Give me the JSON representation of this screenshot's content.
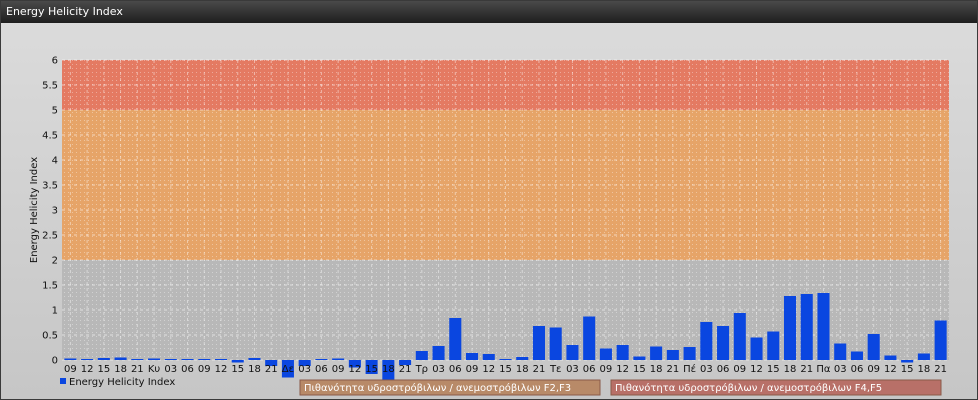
{
  "window": {
    "title": "Energy Helicity Index"
  },
  "chart_data": {
    "type": "bar",
    "title": "Energy Helicity Index",
    "ylabel": "Energy Helicity Index",
    "ylim": [
      0,
      6
    ],
    "yticks": [
      "0",
      "0.5",
      "1",
      "1.5",
      "2",
      "2.5",
      "3",
      "3.5",
      "4",
      "4.5",
      "5",
      "5.5",
      "6"
    ],
    "grid": true,
    "legend_position": "bottom-left",
    "categories": [
      "09",
      "12",
      "15",
      "18",
      "21",
      "Κυ",
      "03",
      "06",
      "09",
      "12",
      "15",
      "18",
      "21",
      "Δε",
      "03",
      "06",
      "09",
      "12",
      "15",
      "18",
      "21",
      "Τρ",
      "03",
      "06",
      "09",
      "12",
      "15",
      "18",
      "21",
      "Τε",
      "03",
      "06",
      "09",
      "12",
      "15",
      "18",
      "21",
      "Πέ",
      "03",
      "06",
      "09",
      "12",
      "15",
      "18",
      "21",
      "Πα",
      "03",
      "06",
      "09",
      "12",
      "15",
      "18",
      "21"
    ],
    "series": [
      {
        "name": "Energy Helicity Index",
        "color": "#0a46e0",
        "values": [
          0.03,
          0.02,
          0.04,
          0.05,
          0.02,
          0.03,
          0.02,
          0.02,
          0.02,
          0.02,
          -0.05,
          0.04,
          -0.12,
          -0.35,
          -0.12,
          0.02,
          0.03,
          -0.15,
          -0.28,
          -0.45,
          -0.1,
          0.18,
          0.28,
          0.84,
          0.14,
          0.12,
          0.02,
          0.06,
          0.68,
          0.65,
          0.3,
          0.87,
          0.23,
          0.3,
          0.07,
          0.27,
          0.2,
          0.26,
          0.76,
          0.68,
          0.94,
          0.45,
          0.57,
          1.28,
          1.32,
          1.34,
          0.33,
          0.17,
          0.52,
          0.09,
          -0.05,
          0.13,
          0.79,
          0.88
        ]
      }
    ],
    "bands": [
      {
        "from": 0,
        "to": 2,
        "color": "#b8b8b8"
      },
      {
        "from": 2,
        "to": 5,
        "color": "#e6a468"
      },
      {
        "from": 5,
        "to": 6,
        "color": "#e47a62"
      }
    ],
    "legend_items": [
      {
        "label": "Πιθανότητα υδροστρόβιλων / ανεμοστρόβιλων F2,F3",
        "color": "#b88a68"
      },
      {
        "label": "Πιθανότητα υδροστρόβιλων / ανεμοστρόβιλων F4,F5",
        "color": "#b87068"
      }
    ]
  }
}
